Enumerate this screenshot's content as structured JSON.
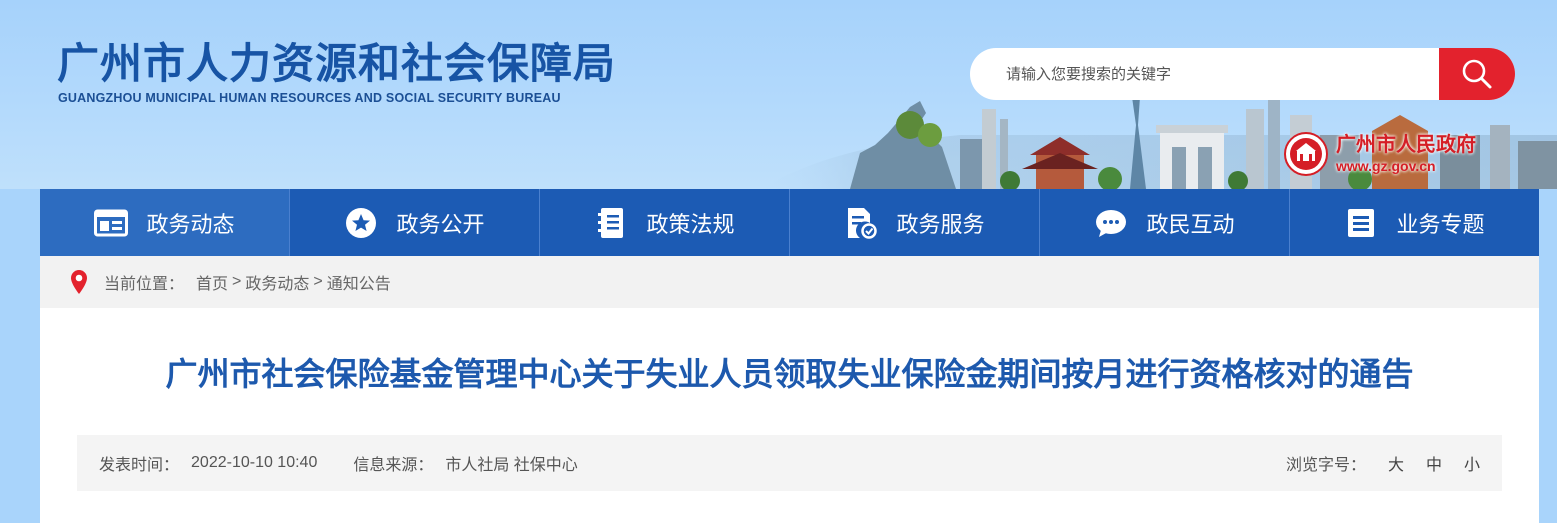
{
  "header": {
    "title_cn": "广州市人力资源和社会保障局",
    "title_en": "GUANGZHOU MUNICIPAL HUMAN RESOURCES AND SOCIAL SECURITY BUREAU"
  },
  "search": {
    "placeholder": "请输入您要搜索的关键字",
    "button_icon": "search-icon"
  },
  "gov_logo": {
    "name": "广州市人民政府",
    "url": "www.gz.gov.cn"
  },
  "nav": {
    "items": [
      {
        "label": "政务动态",
        "icon": "news-icon"
      },
      {
        "label": "政务公开",
        "icon": "star-icon"
      },
      {
        "label": "政策法规",
        "icon": "book-icon"
      },
      {
        "label": "政务服务",
        "icon": "document-service-icon"
      },
      {
        "label": "政民互动",
        "icon": "chat-icon"
      },
      {
        "label": "业务专题",
        "icon": "list-icon"
      }
    ],
    "active_index": 0
  },
  "breadcrumb": {
    "prefix": "当前位置：",
    "items": [
      "首页",
      "政务动态",
      "通知公告"
    ],
    "separator": ">"
  },
  "article": {
    "title": "广州市社会保险基金管理中心关于失业人员领取失业保险金期间按月进行资格核对的通告",
    "publish_label": "发表时间：",
    "publish_time": "2022-10-10 10:40",
    "source_label": "信息来源：",
    "source": "市人社局 社保中心",
    "font_size_label": "浏览字号：",
    "font_sizes": [
      "大",
      "中",
      "小"
    ]
  },
  "colors": {
    "header_bg": "#a9d4fb",
    "brand_blue": "#1754a5",
    "nav_bg": "#1c5bb4",
    "nav_active": "#2d6cc0",
    "search_red": "#e3222d",
    "gov_red": "#d51e26"
  }
}
